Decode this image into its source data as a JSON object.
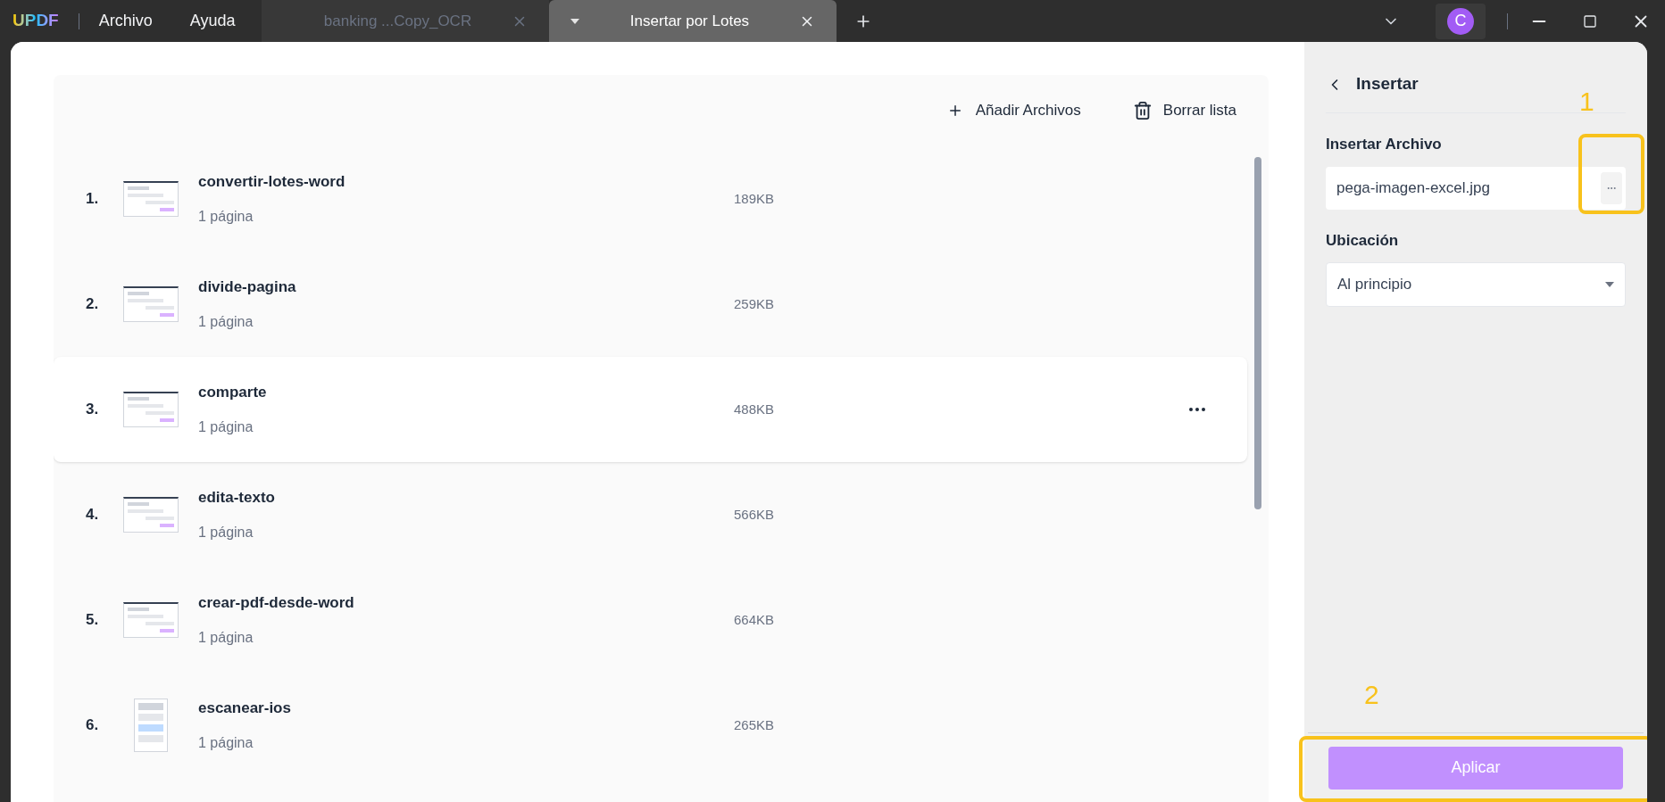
{
  "app": {
    "logo": "UPDF",
    "menu": [
      "Archivo",
      "Ayuda"
    ],
    "avatar": "C"
  },
  "tabs": [
    {
      "label": "banking ...Copy_OCR",
      "selected": false
    },
    {
      "label": "Insertar por Lotes",
      "selected": true
    }
  ],
  "toolbar": {
    "add": "Añadir Archivos",
    "clear": "Borrar lista"
  },
  "files": [
    {
      "index": "1.",
      "name": "convertir-lotes-word",
      "pages": "1 página",
      "size": "189KB",
      "selected": false,
      "kind": "landscape"
    },
    {
      "index": "2.",
      "name": "divide-pagina",
      "pages": "1 página",
      "size": "259KB",
      "selected": false,
      "kind": "landscape"
    },
    {
      "index": "3.",
      "name": "comparte",
      "pages": "1 página",
      "size": "488KB",
      "selected": true,
      "kind": "landscape"
    },
    {
      "index": "4.",
      "name": "edita-texto",
      "pages": "1 página",
      "size": "566KB",
      "selected": false,
      "kind": "landscape"
    },
    {
      "index": "5.",
      "name": "crear-pdf-desde-word",
      "pages": "1 página",
      "size": "664KB",
      "selected": false,
      "kind": "landscape"
    },
    {
      "index": "6.",
      "name": "escanear-ios",
      "pages": "1 página",
      "size": "265KB",
      "selected": false,
      "kind": "portrait"
    }
  ],
  "panel": {
    "title": "Insertar",
    "file_label": "Insertar Archivo",
    "file_value": "pega-imagen-excel.jpg",
    "location_label": "Ubicación",
    "location_value": "Al principio",
    "apply": "Aplicar"
  },
  "annotations": [
    "1",
    "2"
  ]
}
